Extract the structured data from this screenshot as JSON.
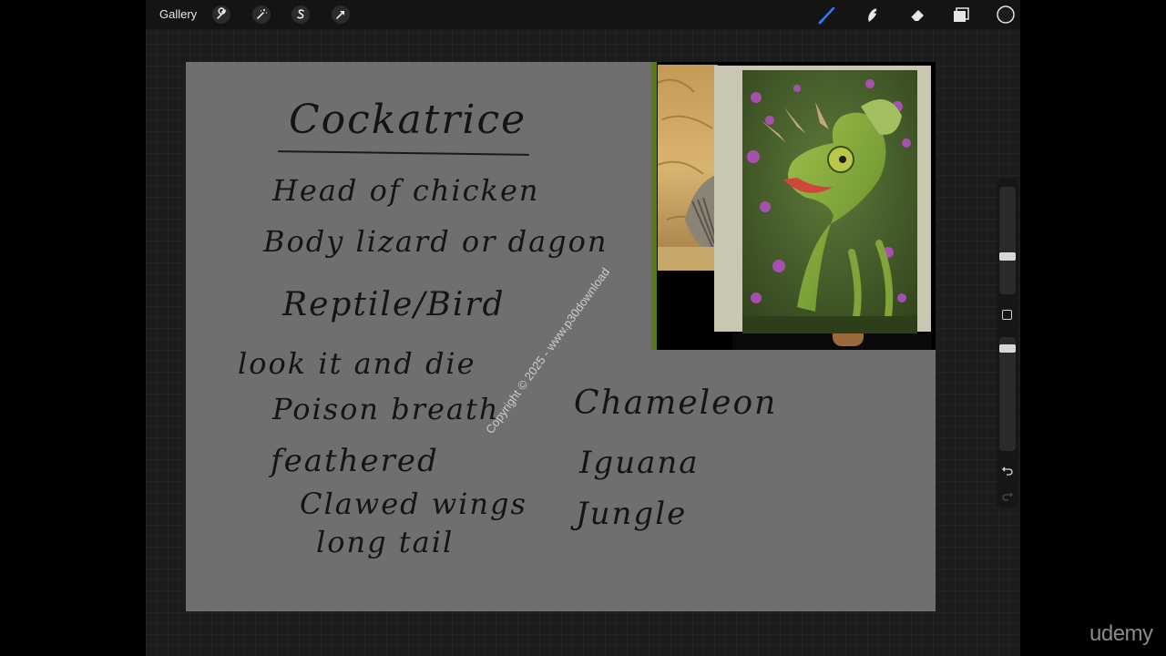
{
  "toolbar": {
    "gallery_label": "Gallery",
    "left_tools": [
      "wrench-icon",
      "magic-wand-icon",
      "selection-icon",
      "transform-arrow-icon"
    ],
    "right_tools": [
      "brush-icon",
      "smudge-icon",
      "eraser-icon",
      "layers-icon",
      "color-swatch-icon"
    ],
    "accent_color": "#2f7df6",
    "active_color": "#1c1c1e"
  },
  "canvas": {
    "background": "#6f6f70",
    "notes_left": {
      "title": "Cockatrice",
      "lines": [
        "Head of chicken",
        "Body lizard or dagon",
        "Reptile/Bird",
        "look it and die",
        "Poison breath",
        "feathered",
        "Clawed wings",
        "long tail"
      ]
    },
    "notes_right": {
      "lines": [
        "Chameleon",
        "Iguana",
        "Jungle"
      ]
    },
    "reference_photos": [
      "bird-photo",
      "chameleon-photo"
    ]
  },
  "sidebar": {
    "controls": [
      "brush-size-slider",
      "modify-button",
      "opacity-slider",
      "undo-icon",
      "redo-icon"
    ]
  },
  "watermark": "Copyright © 2025 - www.p30download",
  "brand": "udemy"
}
